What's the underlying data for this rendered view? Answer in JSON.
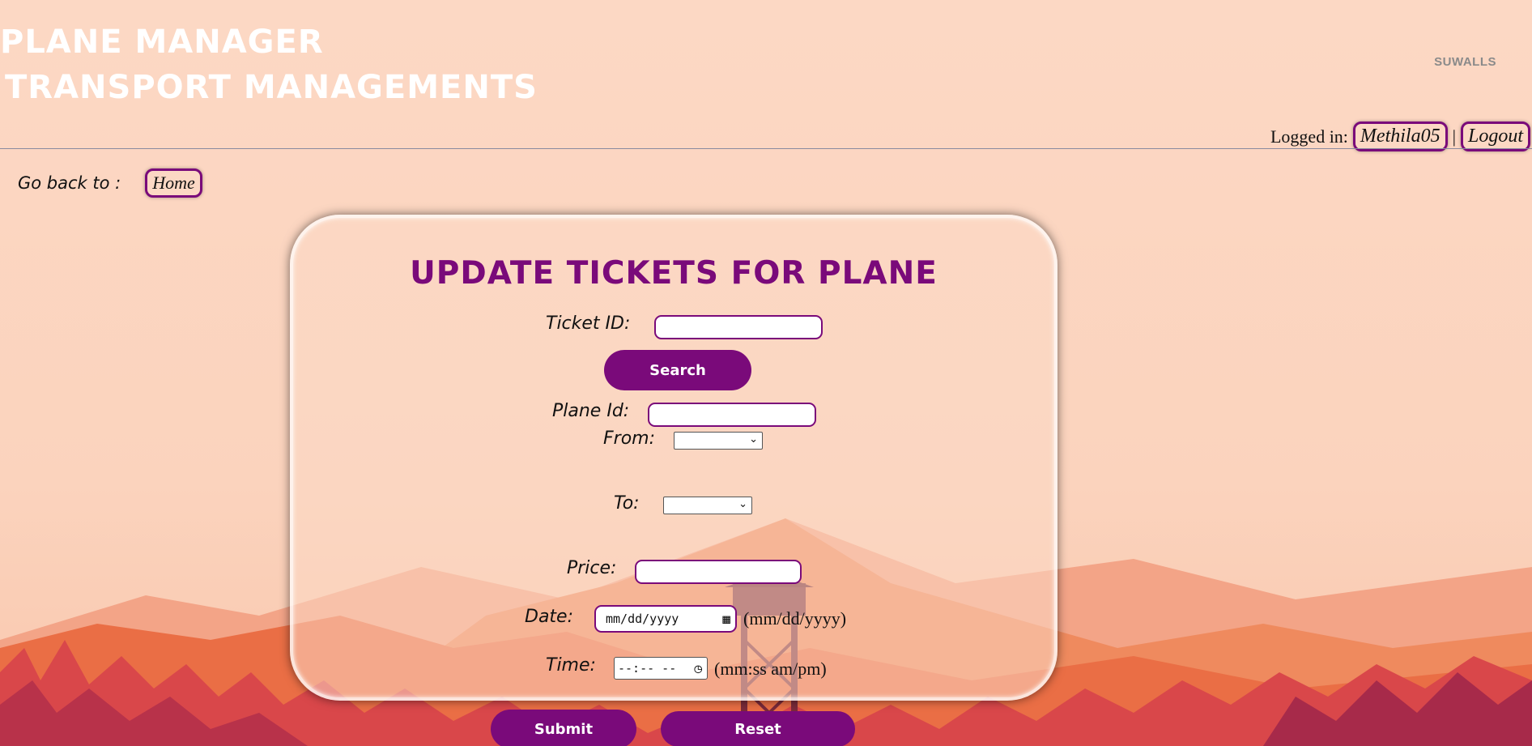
{
  "header": {
    "title_line1": "PLANE MANAGER",
    "title_line2": "TRANSPORT MANAGEMENTS",
    "brand": "SUWALLS"
  },
  "login": {
    "label": "Logged in:",
    "username": "Methila05",
    "separator": "|",
    "logout": "Logout"
  },
  "nav": {
    "go_back_label": "Go back to :",
    "home": "Home"
  },
  "form": {
    "title": "UPDATE TICKETS FOR PLANE",
    "ticket_id_label": "Ticket ID:",
    "ticket_id_value": "",
    "search_button": "Search",
    "plane_id_label": "Plane Id:",
    "plane_id_value": "",
    "from_label": "From:",
    "from_selected": "",
    "to_label": "To:",
    "to_selected": "",
    "price_label": "Price:",
    "price_value": "",
    "date_label": "Date:",
    "date_placeholder": "mm/dd/yyyy",
    "date_hint": "(mm/dd/yyyy)",
    "time_label": "Time:",
    "time_placeholder": "--:-- --",
    "time_hint": "(mm:ss am/pm)",
    "submit_button": "Submit",
    "reset_button": "Reset"
  },
  "icons": {
    "calendar": "calendar-icon",
    "clock": "clock-icon",
    "chevron": "chevron-down-icon"
  },
  "colors": {
    "accent": "#7a0a7a",
    "background": "#fcd8c4",
    "header_text": "#ffffff"
  }
}
